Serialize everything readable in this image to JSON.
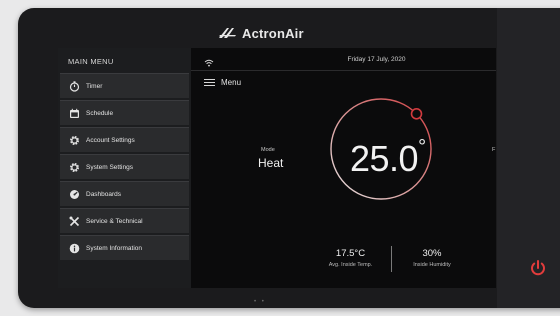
{
  "brand": {
    "name": "ActronAir"
  },
  "menu": {
    "title": "MAIN MENU",
    "items": [
      {
        "label": "Timer",
        "icon": "timer-icon"
      },
      {
        "label": "Schedule",
        "icon": "calendar-icon"
      },
      {
        "label": "Account Settings",
        "icon": "gear-icon"
      },
      {
        "label": "System Settings",
        "icon": "gear-icon"
      },
      {
        "label": "Dashboards",
        "icon": "gauge-icon"
      },
      {
        "label": "Service & Technical",
        "icon": "tools-icon"
      },
      {
        "label": "System Information",
        "icon": "info-icon"
      }
    ]
  },
  "status": {
    "date": "Friday 17 July, 2020",
    "wifi_icon": "wifi-icon"
  },
  "header": {
    "menu_label": "Menu"
  },
  "mode": {
    "caption": "Mode",
    "value": "Heat"
  },
  "setpoint": {
    "value": "25.0",
    "unit_symbol": "°"
  },
  "right_cut_text": "F",
  "stats": {
    "inside_temp": {
      "value": "17.5°C",
      "caption": "Avg. Inside Temp."
    },
    "inside_humidity": {
      "value": "30%",
      "caption": "Inside Humidity"
    }
  },
  "footer": {
    "dots": "• •"
  },
  "colors": {
    "accent": "#d23a3e",
    "dial_track": "#e0e0e0",
    "power": "#e23c3c"
  }
}
